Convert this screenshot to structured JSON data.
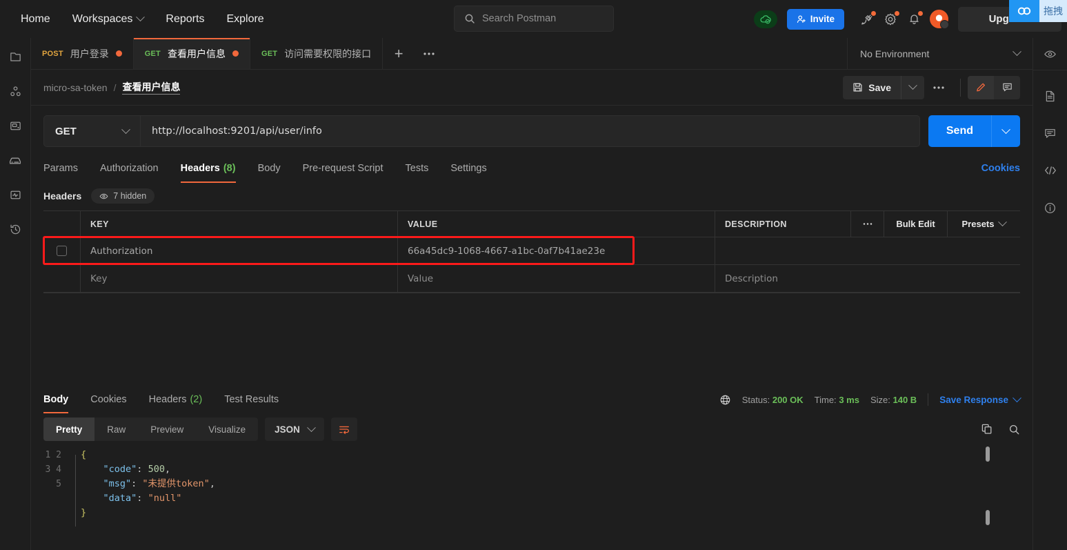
{
  "topnav": {
    "items": [
      {
        "label": "Home",
        "has_caret": false
      },
      {
        "label": "Workspaces",
        "has_caret": true
      },
      {
        "label": "Reports",
        "has_caret": false
      },
      {
        "label": "Explore",
        "has_caret": false
      }
    ],
    "search_placeholder": "Search Postman",
    "invite_label": "Invite",
    "upgrade_label": "Upgrade",
    "icons": [
      "cloud-sync-icon",
      "invite-icon",
      "satellite-icon",
      "gear-icon",
      "bell-icon",
      "avatar"
    ],
    "accent_blue": "#1a73e8"
  },
  "overlay_widget": {
    "icon_name": "link-chain-icon",
    "label": "拖拽",
    "bg": "#2196f3"
  },
  "left_rail": {
    "items": [
      {
        "name": "collections-icon"
      },
      {
        "name": "apis-icon"
      },
      {
        "name": "environments-icon"
      },
      {
        "name": "mock-servers-icon"
      },
      {
        "name": "monitors-icon"
      },
      {
        "name": "history-icon"
      }
    ]
  },
  "right_rail": {
    "items": [
      {
        "name": "eye-icon"
      },
      {
        "name": "documentation-icon"
      },
      {
        "name": "comments-icon"
      },
      {
        "name": "code-snippet-icon"
      },
      {
        "name": "info-icon"
      }
    ]
  },
  "request_tabs": {
    "tabs": [
      {
        "method": "POST",
        "name": "用户登录",
        "unsaved": true,
        "active": false
      },
      {
        "method": "GET",
        "name": "查看用户信息",
        "unsaved": true,
        "active": true
      },
      {
        "method": "GET",
        "name": "访问需要权限的接口",
        "unsaved": false,
        "active": false
      }
    ],
    "plus_label": "+",
    "environment_label": "No Environment"
  },
  "breadcrumb": {
    "parent": "micro-sa-token",
    "separator": "/",
    "current": "查看用户信息",
    "save_label": "Save"
  },
  "url_bar": {
    "method": "GET",
    "url": "http://localhost:9201/api/user/info",
    "send_label": "Send"
  },
  "request_tabs_row": {
    "tabs": [
      {
        "label": "Params",
        "count": "",
        "active": false
      },
      {
        "label": "Authorization",
        "count": "",
        "active": false
      },
      {
        "label": "Headers",
        "count": "(8)",
        "active": true
      },
      {
        "label": "Body",
        "count": "",
        "active": false
      },
      {
        "label": "Pre-request Script",
        "count": "",
        "active": false
      },
      {
        "label": "Tests",
        "count": "",
        "active": false
      },
      {
        "label": "Settings",
        "count": "",
        "active": false
      }
    ],
    "cookies_label": "Cookies"
  },
  "headers_section": {
    "title": "Headers",
    "hidden_pill": "7 hidden",
    "columns": [
      "KEY",
      "VALUE",
      "DESCRIPTION"
    ],
    "bulk_edit_label": "Bulk Edit",
    "presets_label": "Presets",
    "rows": [
      {
        "key": "Authorization",
        "value": "66a45dc9-1068-4667-a1bc-0af7b41ae23e",
        "description": "",
        "checked": false,
        "highlighted": true
      }
    ],
    "placeholder_row": {
      "key": "Key",
      "value": "Value",
      "description": "Description"
    },
    "highlight_color": "#fb1a1a"
  },
  "response": {
    "tabs": [
      {
        "label": "Body",
        "count": "",
        "active": true
      },
      {
        "label": "Cookies",
        "count": "",
        "active": false
      },
      {
        "label": "Headers",
        "count": "(2)",
        "active": false
      },
      {
        "label": "Test Results",
        "count": "",
        "active": false
      }
    ],
    "status_label": "Status:",
    "status_value": "200 OK",
    "time_label": "Time:",
    "time_value": "3 ms",
    "size_label": "Size:",
    "size_value": "140 B",
    "save_response_label": "Save Response",
    "view_modes": [
      {
        "label": "Pretty",
        "active": true
      },
      {
        "label": "Raw",
        "active": false
      },
      {
        "label": "Preview",
        "active": false
      },
      {
        "label": "Visualize",
        "active": false
      }
    ],
    "format": "JSON",
    "body_lines": [
      "1",
      "2",
      "3",
      "4",
      "5"
    ],
    "body": {
      "line1": "{",
      "line2_key": "\"code\"",
      "line2_val": "500",
      "line2_sep": ": ",
      "line2_end": ",",
      "line3_key": "\"msg\"",
      "line3_val": "\"未提供token\"",
      "line3_sep": ": ",
      "line3_end": ",",
      "line4_key": "\"data\"",
      "line4_val": "\"null\"",
      "line4_sep": ": ",
      "line5": "}"
    }
  }
}
